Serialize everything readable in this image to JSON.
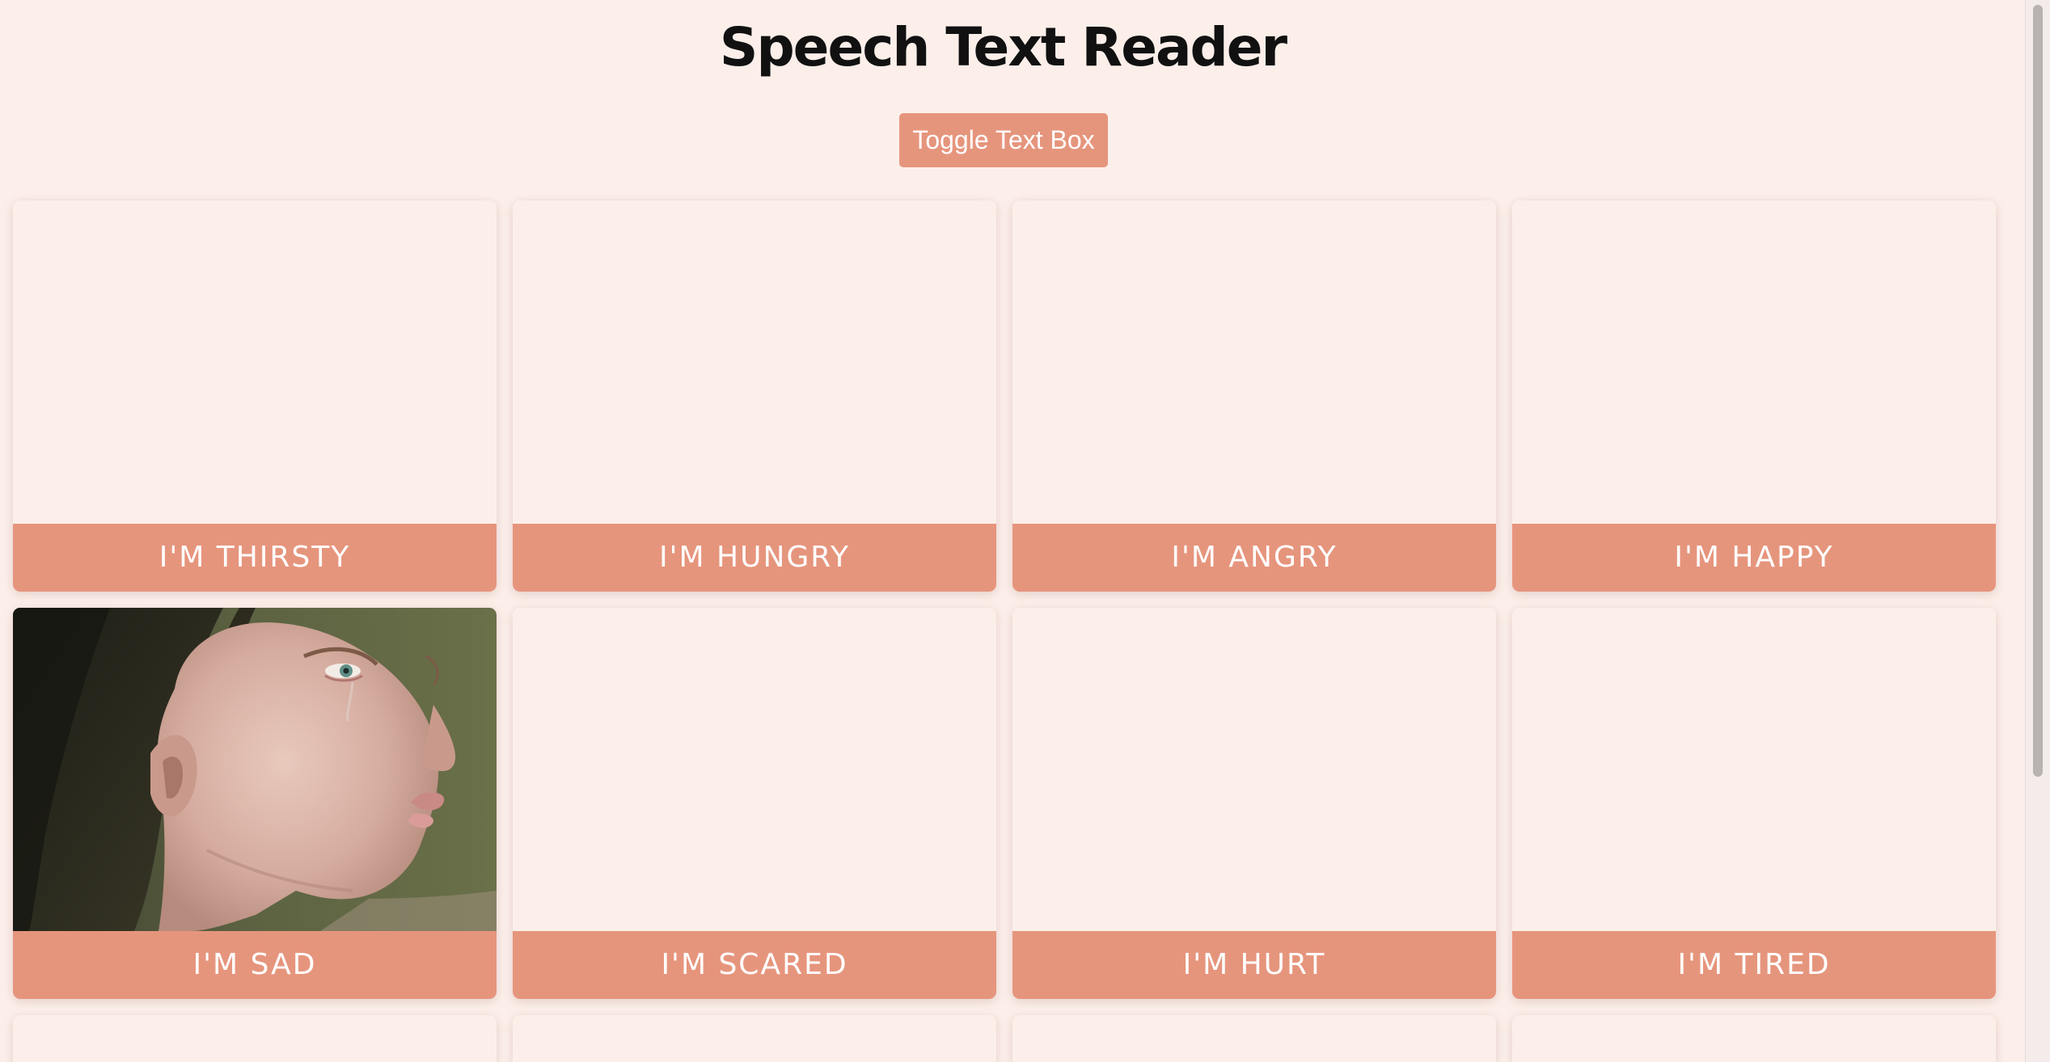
{
  "header": {
    "title": "Speech Text Reader"
  },
  "toolbar": {
    "toggle_label": "Toggle Text Box"
  },
  "cards": [
    {
      "label": "I'M THIRSTY",
      "image": "none"
    },
    {
      "label": "I'M HUNGRY",
      "image": "none"
    },
    {
      "label": "I'M ANGRY",
      "image": "none"
    },
    {
      "label": "I'M HAPPY",
      "image": "none"
    },
    {
      "label": "I'M SAD",
      "image": "photo-of-crying-woman"
    },
    {
      "label": "I'M SCARED",
      "image": "none"
    },
    {
      "label": "I'M HURT",
      "image": "none"
    },
    {
      "label": "I'M TIRED",
      "image": "none"
    }
  ],
  "colors": {
    "background": "#fcefea",
    "accent": "#e6957d",
    "label_text": "#ffffff",
    "title_text": "#111111"
  }
}
